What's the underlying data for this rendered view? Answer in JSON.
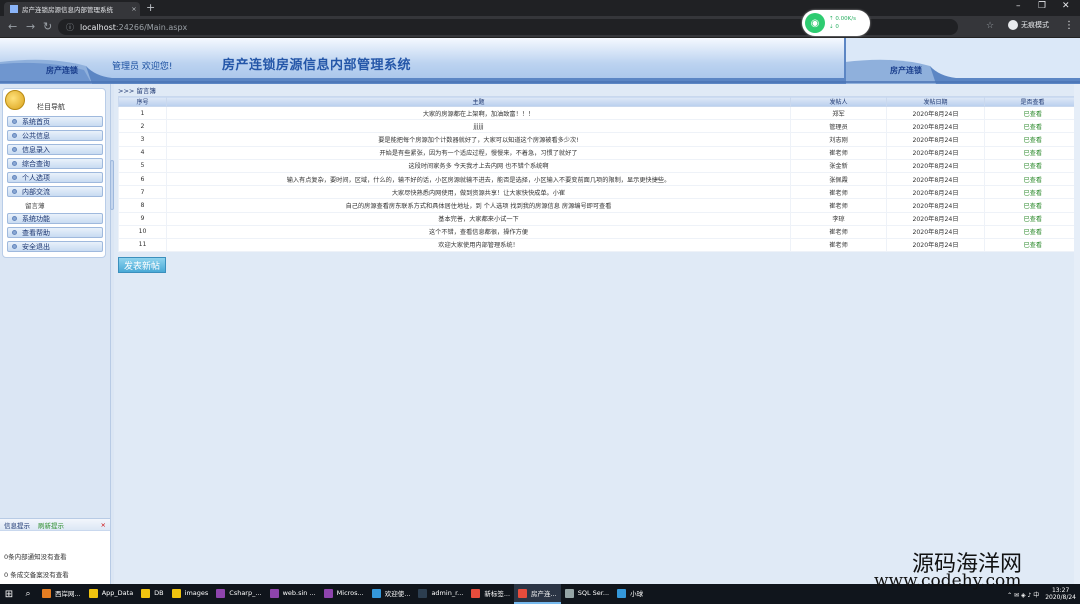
{
  "browser": {
    "tab_title": "房产连锁房源信息内部管理系统",
    "url_host": "localhost",
    "url_path": ":24266/Main.aspx",
    "profile_label": "无痕模式",
    "network_up": "0.00K/s",
    "network_down": "0"
  },
  "header": {
    "brand": "房产连锁",
    "welcome": "管理员 欢迎您!",
    "title": "房产连锁房源信息内部管理系统"
  },
  "sidebar": {
    "nav_title": "栏目导航",
    "items": [
      {
        "label": "系统首页"
      },
      {
        "label": "公共信息"
      },
      {
        "label": "信息录入"
      },
      {
        "label": "综合查询"
      },
      {
        "label": "个人选项"
      },
      {
        "label": "内部交流"
      }
    ],
    "sub_item": "留言薄",
    "items_after": [
      {
        "label": "系统功能"
      },
      {
        "label": "查看帮助"
      },
      {
        "label": "安全退出"
      }
    ]
  },
  "message_box": {
    "tab1": "信息提示",
    "tab2": "刷新提示",
    "close": "×",
    "line1": "0条内部通知没有查看",
    "line2": "0 条成交备案没有查看"
  },
  "main": {
    "breadcrumb": ">>> 留言簿",
    "columns": [
      "序号",
      "主题",
      "发帖人",
      "发帖日期",
      "是否查看"
    ],
    "rows": [
      {
        "no": "1",
        "subject": "大家的房源都在上架啊，加油致富！！！",
        "author": "郑军",
        "date": "2020年8月24日",
        "status": "已查看"
      },
      {
        "no": "2",
        "subject": "jjjjjj",
        "author": "管理员",
        "date": "2020年8月24日",
        "status": "已查看"
      },
      {
        "no": "3",
        "subject": "要是能把每个房源加个计数器就好了，大家可以知道这个房源被看多少次!",
        "author": "刘志刚",
        "date": "2020年8月24日",
        "status": "已查看"
      },
      {
        "no": "4",
        "subject": "开始是有些紧张，因为有一个适应过程，慢慢来，不着急，习惯了就好了",
        "author": "崔老师",
        "date": "2020年8月24日",
        "status": "已查看"
      },
      {
        "no": "5",
        "subject": "这段时间家务多 今天我才上去内网 也不错个系统啊",
        "author": "张金新",
        "date": "2020年8月24日",
        "status": "已查看"
      },
      {
        "no": "6",
        "subject": "输入有点复杂，要时间，区域，什么的，输不好的话，小区房源就输不进去，能否是选择，小区输入不要变前面几项的限制，显示更快捷些。",
        "author": "张佩霞",
        "date": "2020年8月24日",
        "status": "已查看"
      },
      {
        "no": "7",
        "subject": "大家尽快熟悉内网使用，做到资源共享！让大家快快成单。小崔",
        "author": "崔老师",
        "date": "2020年8月24日",
        "status": "已查看"
      },
      {
        "no": "8",
        "subject": "自己的房源查看房东联系方式和具体居住地址，到 个人选项 找到我的房源信息 房源编号即可查看",
        "author": "崔老师",
        "date": "2020年8月24日",
        "status": "已查看"
      },
      {
        "no": "9",
        "subject": "基本完善，大家都来小试一下",
        "author": "李琼",
        "date": "2020年8月24日",
        "status": "已查看"
      },
      {
        "no": "10",
        "subject": "这个不错，查看信息都很，操作方便",
        "author": "崔老师",
        "date": "2020年8月24日",
        "status": "已查看"
      },
      {
        "no": "11",
        "subject": "欢迎大家使用内部管理系统！",
        "author": "崔老师",
        "date": "2020年8月24日",
        "status": "已查看"
      }
    ],
    "post_button": "发表新帖"
  },
  "taskbar": {
    "items": [
      {
        "label": "西岸网...",
        "color": "#e67e22"
      },
      {
        "label": "App_Data",
        "color": "#f1c40f"
      },
      {
        "label": "DB",
        "color": "#f1c40f"
      },
      {
        "label": "images",
        "color": "#f1c40f"
      },
      {
        "label": "Csharp_...",
        "color": "#8e44ad"
      },
      {
        "label": "web.sin ...",
        "color": "#8e44ad"
      },
      {
        "label": "Micros...",
        "color": "#8e44ad"
      },
      {
        "label": "欢迎使...",
        "color": "#3498db"
      },
      {
        "label": "admin_r...",
        "color": "#2c3e50"
      },
      {
        "label": "新标签...",
        "color": "#e74c3c"
      },
      {
        "label": "房产连...",
        "color": "#e74c3c"
      },
      {
        "label": "SQL Ser...",
        "color": "#95a5a6"
      },
      {
        "label": "小球",
        "color": "#3498db"
      }
    ],
    "time": "13:27",
    "date": "2020/8/24"
  },
  "watermark": {
    "line1": "源码海洋网",
    "line2": "www.codehy.com"
  },
  "colors": {
    "header_accent": "#2456a8",
    "status_green": "#2e8b2e",
    "post_button": "#4aa9d6"
  }
}
